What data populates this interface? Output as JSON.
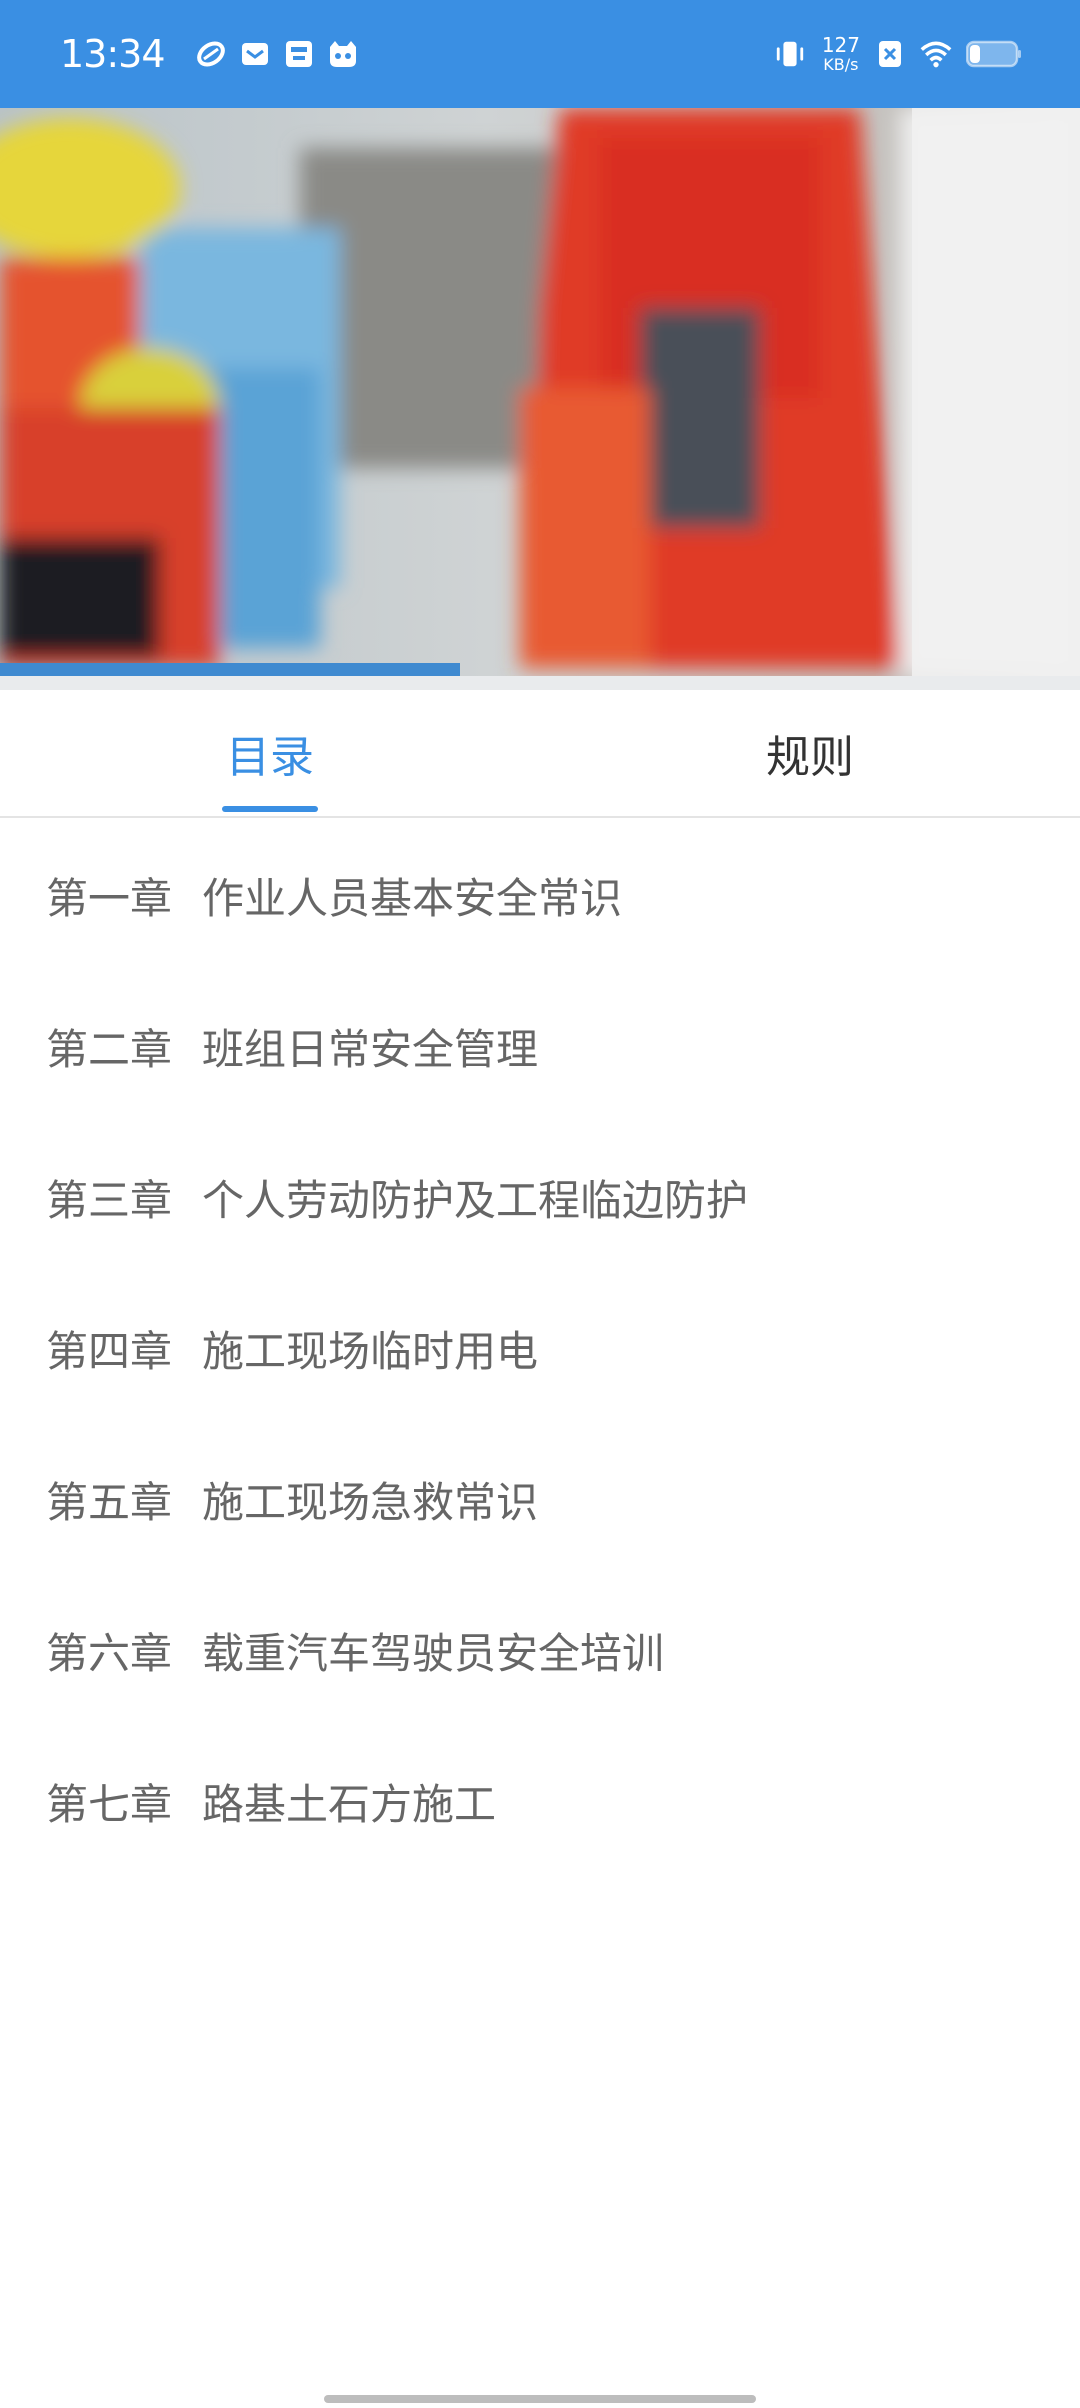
{
  "status_bar": {
    "time": "13:34",
    "left_icons": [
      "swirl-app-icon",
      "mail-app-icon",
      "inbox-app-icon",
      "mascot-app-icon"
    ],
    "net_speed_value": "127",
    "net_speed_unit": "KB/s",
    "right_icons": [
      "vibrate-icon",
      "sim-blocked-icon",
      "wifi-icon",
      "battery-icon"
    ]
  },
  "banner": {
    "description_icon": "banner-image"
  },
  "tabs": [
    {
      "label": "目录",
      "active": true
    },
    {
      "label": "规则",
      "active": false
    }
  ],
  "chapters": [
    {
      "number": "第一章",
      "title": "作业人员基本安全常识"
    },
    {
      "number": "第二章",
      "title": "班组日常安全管理"
    },
    {
      "number": "第三章",
      "title": "个人劳动防护及工程临边防护"
    },
    {
      "number": "第四章",
      "title": "施工现场临时用电"
    },
    {
      "number": "第五章",
      "title": "施工现场急救常识"
    },
    {
      "number": "第六章",
      "title": "载重汽车驾驶员安全培训"
    },
    {
      "number": "第七章",
      "title": "路基土石方施工"
    }
  ],
  "colors": {
    "accent": "#3a8fe3",
    "text_primary": "#333333",
    "text_secondary": "#666666"
  }
}
